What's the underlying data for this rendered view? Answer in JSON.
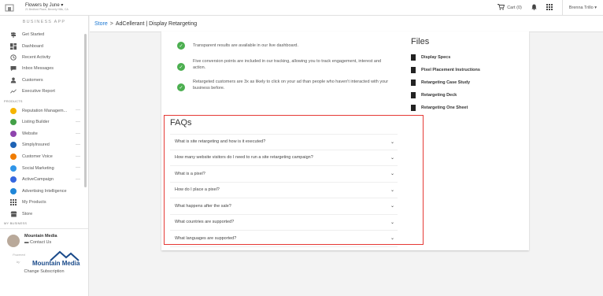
{
  "topbar": {
    "business_name": "Flowers by June ▾",
    "business_address": "21 Bedford Place, Beverly Hills, CA",
    "cart_label": "Cart (0)",
    "user_label": "Brenna Trillo ▾"
  },
  "sidebar": {
    "title": "BUSINESS APP",
    "items": [
      {
        "label": "Get Started",
        "icon": "signpost-icon"
      },
      {
        "label": "Dashboard",
        "icon": "dashboard-icon"
      },
      {
        "label": "Recent Activity",
        "icon": "history-icon"
      },
      {
        "label": "Inbox Messages",
        "icon": "inbox-icon"
      },
      {
        "label": "Customers",
        "icon": "person-icon"
      },
      {
        "label": "Executive Report",
        "icon": "trend-icon"
      }
    ],
    "products_heading": "PRODUCTS",
    "products": [
      {
        "label": "Reputation Managem...",
        "color": "#f5b400"
      },
      {
        "label": "Listing Builder",
        "color": "#43a047"
      },
      {
        "label": "Website",
        "color": "#8e44ad"
      },
      {
        "label": "SimplyInsured",
        "color": "#1e63b5"
      },
      {
        "label": "Customer Voice",
        "color": "#f07c00"
      },
      {
        "label": "Social Marketing",
        "color": "#2f95e8"
      },
      {
        "label": "ActiveCampaign",
        "color": "#3567e0"
      },
      {
        "label": "Advertising Intelligence",
        "color": "#1f86d8"
      }
    ],
    "my_products": "My Products",
    "store": "Store",
    "my_business_heading": "MY BUSINESS",
    "partner_name": "Mountain Media",
    "contact_us": "Contact Us",
    "powered": "Powered",
    "by": "by",
    "logo_text": "Mountain Media",
    "change_subscription": "Change Subscription"
  },
  "breadcrumb": {
    "store": "Store",
    "separator": ">",
    "current": "AdCellerant | Display Retargeting"
  },
  "benefits": [
    "Transparent results are available in our live dashboard.",
    "Five conversion points are included in our tracking, allowing you to track engagement, interest and action.",
    "Retargeted customers are 3x as likely to click on your ad than people who haven't interacted with your business before."
  ],
  "files": {
    "title": "Files",
    "links": [
      "Display Specs",
      "Pixel Placement Instructions",
      "Retargeting Case Study",
      "Retargeting Deck",
      "Retargeting One Sheet"
    ]
  },
  "faqs": {
    "title": "FAQs",
    "items": [
      "What is site retargeting and how is it executed?",
      "How many website visitors do I need to run a site retargeting campaign?",
      "What is a pixel?",
      "How do I place a pixel?",
      "What happens after the sale?",
      "What countries are supported?",
      "What languages are supported?"
    ]
  },
  "colors": {
    "accent": "#1976d2",
    "check": "#4caf50",
    "highlight": "#e53935"
  }
}
